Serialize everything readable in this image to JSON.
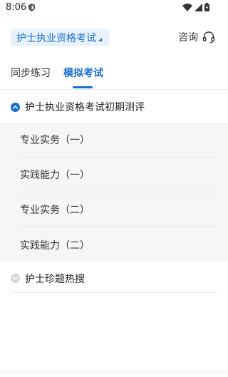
{
  "status_bar": {
    "time": "8:06"
  },
  "header": {
    "exam_select_label": "护士执业资格考试",
    "consult_label": "咨询"
  },
  "tabs": [
    {
      "label": "同步练习",
      "active": false
    },
    {
      "label": "模拟考试",
      "active": true
    }
  ],
  "sections": [
    {
      "title": "护士执业资格考试初期测评",
      "expanded": true,
      "items": [
        {
          "label": "专业实务（一）"
        },
        {
          "label": "实践能力（一）"
        },
        {
          "label": "专业实务（二）"
        },
        {
          "label": "实践能力（二）"
        }
      ]
    },
    {
      "title": "护士珍题热搜",
      "expanded": false
    }
  ],
  "colors": {
    "accent": "#1a6fd4",
    "accent_bg": "#e8f2fd",
    "list_bg": "#f6f6f6"
  }
}
